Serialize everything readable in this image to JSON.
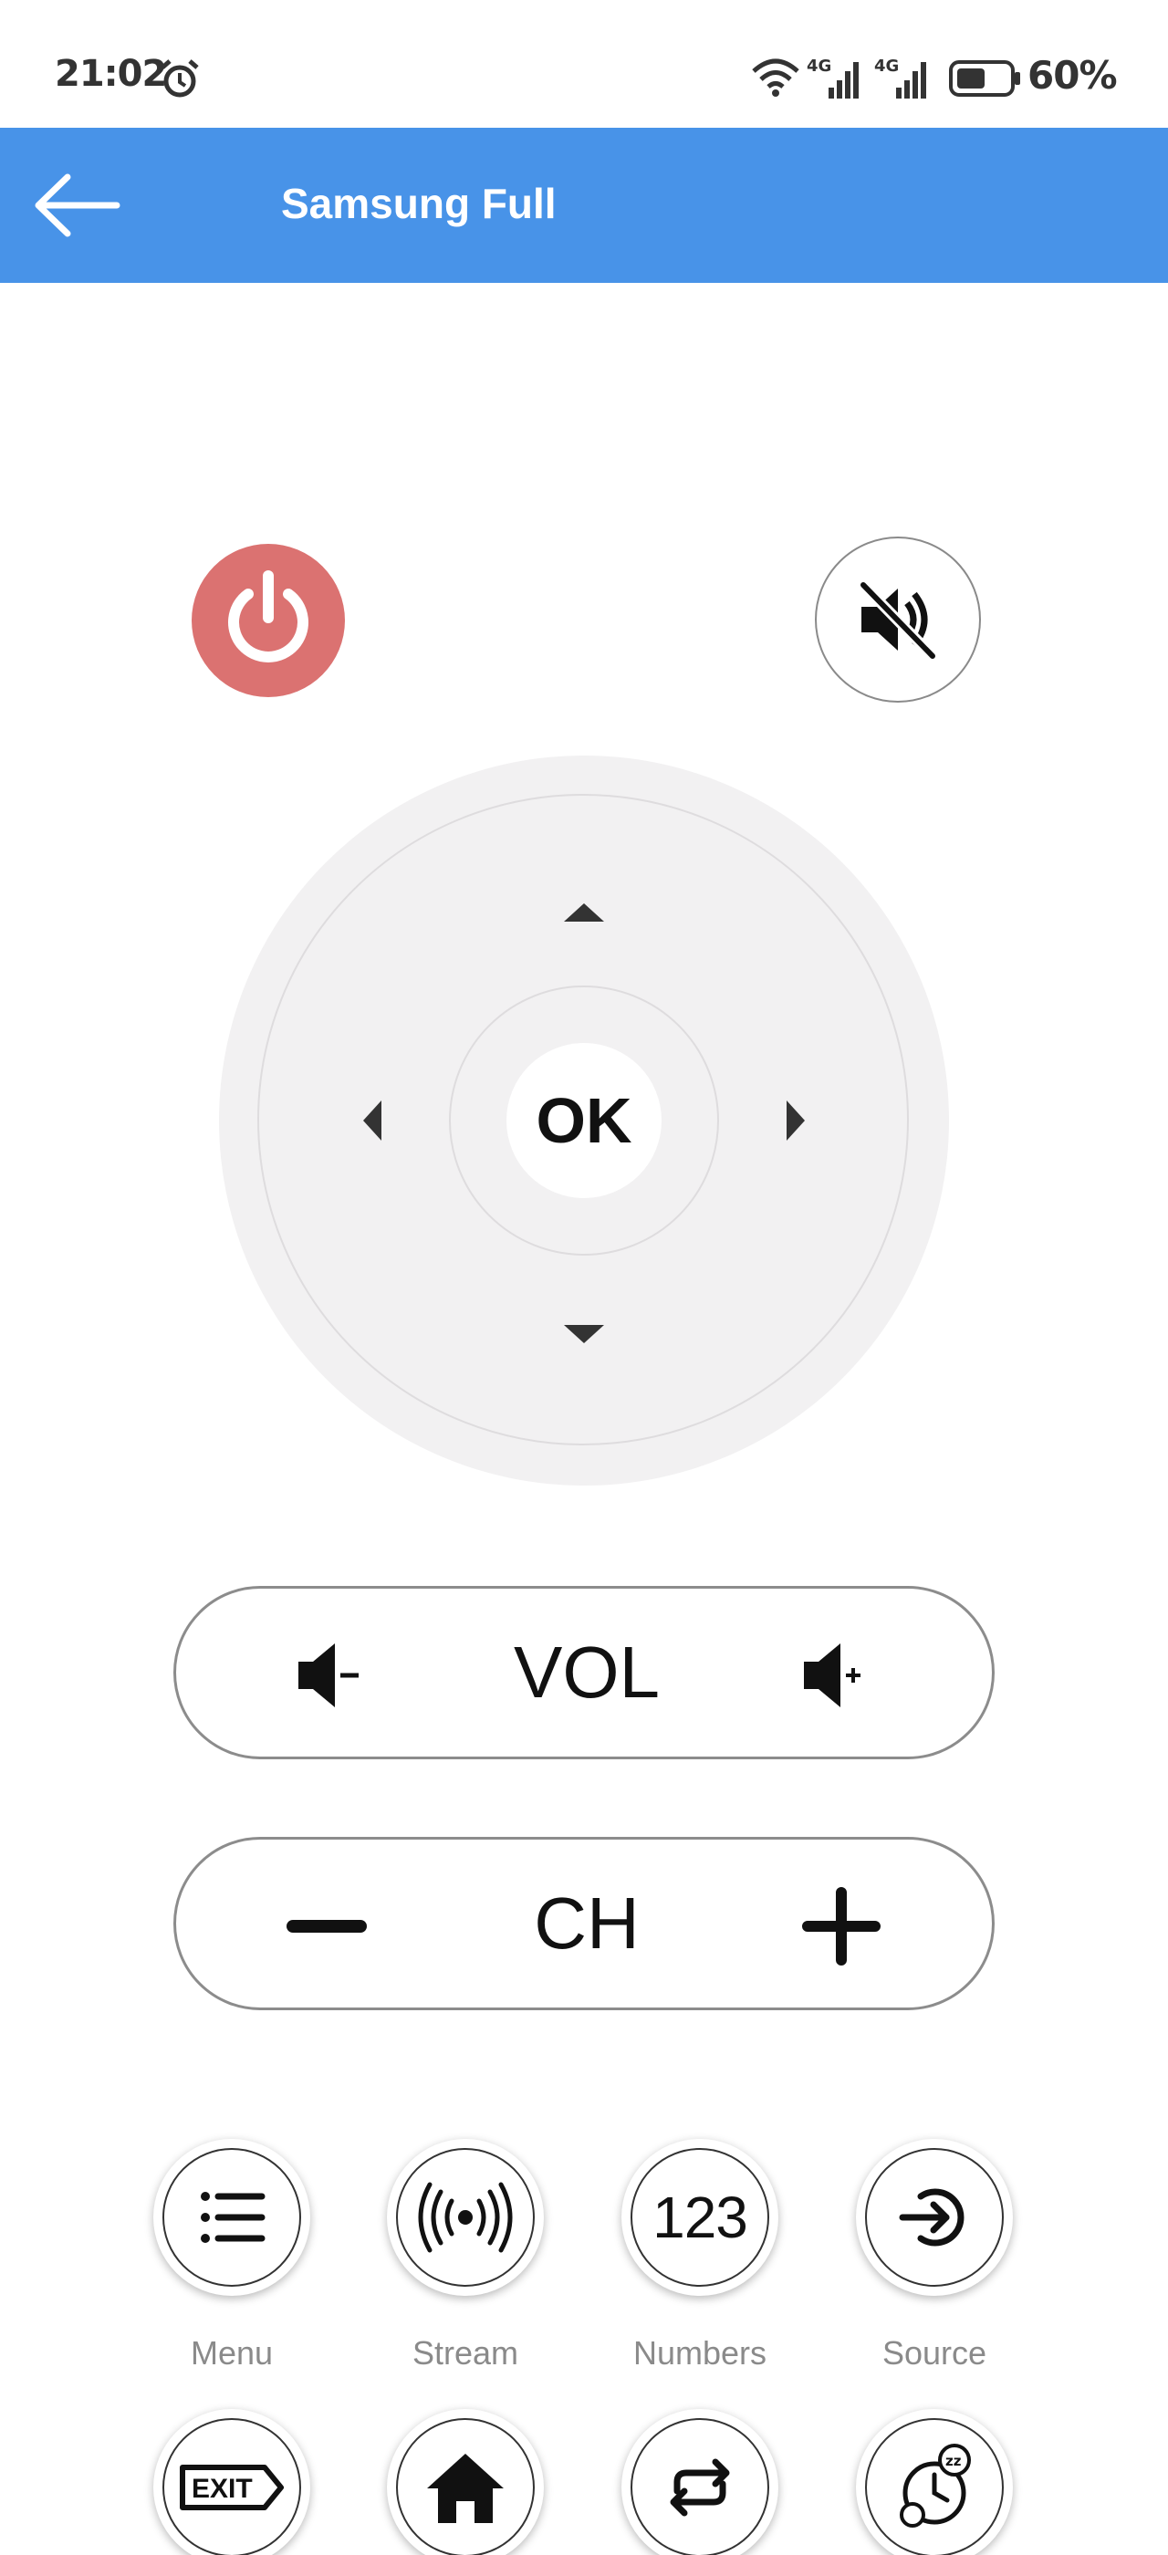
{
  "status_bar": {
    "time": "21:02",
    "battery_percent": "60%",
    "network_label_1": "4G",
    "network_label_2": "4G",
    "icons": [
      "alarm-icon",
      "wifi-icon",
      "signal-icon",
      "signal-icon",
      "battery-icon"
    ]
  },
  "app_bar": {
    "title": "Samsung Full",
    "color": "#4893E8",
    "back_icon": "arrow-left-icon"
  },
  "remote": {
    "power_color": "#DB7271",
    "ok_label": "OK",
    "volume_label": "VOL",
    "channel_label": "CH"
  },
  "function_buttons": [
    {
      "label": "Menu",
      "icon": "list-icon"
    },
    {
      "label": "Stream",
      "icon": "broadcast-icon"
    },
    {
      "label": "Numbers",
      "icon": "numbers-icon",
      "icon_text": "123"
    },
    {
      "label": "Source",
      "icon": "input-source-icon"
    }
  ],
  "function_buttons_row2": [
    {
      "icon": "exit-icon",
      "icon_text": "EXIT"
    },
    {
      "icon": "home-icon"
    },
    {
      "icon": "repeat-icon"
    },
    {
      "icon": "sleep-timer-icon",
      "icon_text": "zz"
    }
  ]
}
